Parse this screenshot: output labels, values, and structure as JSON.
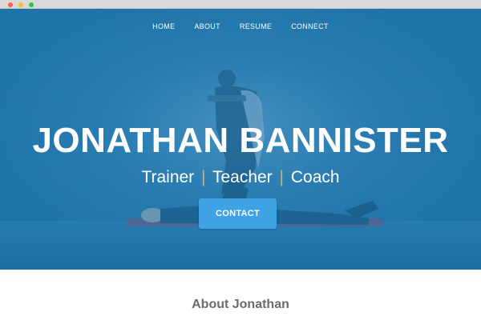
{
  "window": {
    "controls": [
      "close",
      "minimize",
      "maximize"
    ]
  },
  "nav": {
    "items": [
      {
        "label": "HOME"
      },
      {
        "label": "ABOUT"
      },
      {
        "label": "RESUME"
      },
      {
        "label": "CONNECT"
      }
    ]
  },
  "hero": {
    "title": "JONATHAN BANNISTER",
    "subtitle": {
      "part1": "Trainer",
      "separator": "|",
      "part2": "Teacher",
      "part3": "Coach"
    },
    "cta_label": "CONTACT",
    "background_description_icon": "trainer-photo-icon"
  },
  "about": {
    "heading": "About Jonathan"
  },
  "colors": {
    "hero_overlay": "#1f75a8",
    "accent_button": "#3ea2e3",
    "separator": "#e2a866",
    "heading_text": "#6b6b6b",
    "dot_red": "#fe5f57",
    "dot_yellow": "#febc2e",
    "dot_green": "#28c840"
  }
}
